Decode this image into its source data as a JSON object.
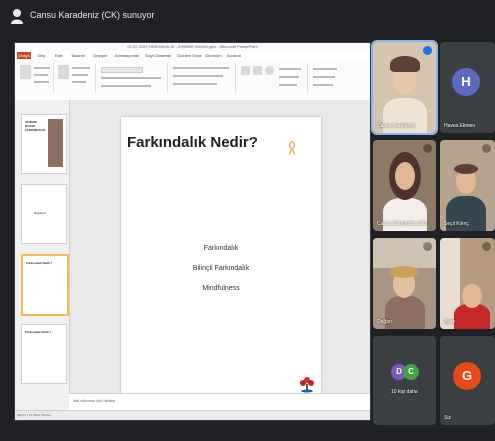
{
  "meeting": {
    "presenting_label": "Cansu Karadeniz (CK) sunuyor"
  },
  "powerpoint": {
    "title": "02.02.2022 FARKINDALIK - ZİHİNDE BAKIM.pptx - Microsoft PowerPoint",
    "file_tab": "Dosya",
    "tabs": [
      "Giriş",
      "Ekle",
      "Tasarım",
      "Geçişler",
      "Animasyonlar",
      "Slayt Gösterisi",
      "Gözden Geçir",
      "Görünüm",
      "Acrobat"
    ],
    "thumbnails": [
      {
        "text": "ZİHİNDE BAKIM FARKINDALIK",
        "selected": false
      },
      {
        "text": "Başlıksız",
        "selected": false
      },
      {
        "text": "Farkındalık Nedir?",
        "selected": true
      },
      {
        "text": "Farkındalık Nedir?",
        "selected": false
      }
    ],
    "slide": {
      "title": "Farkındalık Nedir?",
      "lines": [
        "Farkındalık",
        "Bilinçli Farkındalık",
        "Mindfulness"
      ]
    },
    "notes_placeholder": "Not eklemek için tıklatın",
    "status": "Slayt 3 / 21   Office Teması"
  },
  "participants": [
    {
      "name": "Cansu Karadeniz",
      "type": "video",
      "selected": true,
      "bg": "#c9b8a3"
    },
    {
      "name": "Havva Ekmen",
      "type": "avatar",
      "initial": "H",
      "color": "#5c6bc0"
    },
    {
      "name": "Cansu Karadeniz (CK)",
      "type": "video",
      "bg": "#8d7a66"
    },
    {
      "name": "Seçil Kılınç",
      "type": "video",
      "bg": "#b7a48f"
    },
    {
      "name": "Doğan",
      "type": "video",
      "bg": "#a89583"
    },
    {
      "name": "Ayşe",
      "type": "video",
      "bg": "#b49a82"
    },
    {
      "name": "10 kişi daha",
      "type": "more",
      "initials": [
        "D",
        "C"
      ],
      "colors": [
        "#7e57c2",
        "#43a047"
      ]
    },
    {
      "name": "Siz",
      "type": "avatar",
      "initial": "G",
      "color": "#e64a19"
    }
  ]
}
